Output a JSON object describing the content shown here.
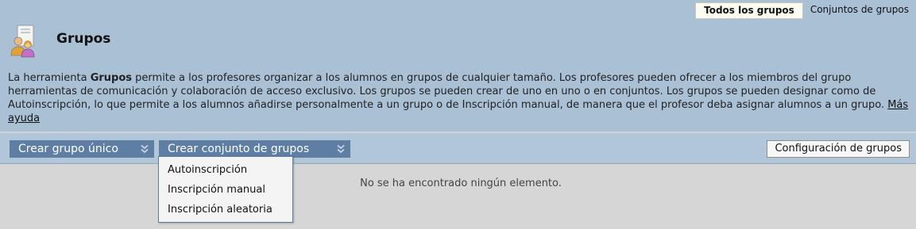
{
  "view_tabs": [
    {
      "label": "Todos los grupos",
      "active": true
    },
    {
      "label": "Conjuntos de grupos",
      "active": false
    }
  ],
  "page": {
    "title": "Grupos",
    "icon": "group-people-icon"
  },
  "description": {
    "part1": "La herramienta ",
    "bold": "Grupos",
    "part2": " permite a los profesores organizar a los alumnos en grupos de cualquier tamaño. Los profesores pueden ofrecer a los miembros del grupo herramientas de comunicación y colaboración de acceso exclusivo. Los grupos se pueden crear de uno en uno o en conjuntos. Los grupos se pueden designar como de Autoinscripción, lo que permite a los alumnos añadirse personalmente a un grupo o de Inscripción manual, de manera que el profesor deba asignar alumnos a un grupo. ",
    "help_link": "Más ayuda"
  },
  "actions": {
    "create_single": "Crear grupo único",
    "create_set": "Crear conjunto de grupos",
    "config": "Configuración de grupos"
  },
  "dropdown": {
    "items": [
      "Autoinscripción",
      "Inscripción manual",
      "Inscripción aleatoria"
    ]
  },
  "empty_message": "No se ha encontrado ningún elemento.",
  "colors": {
    "header_bg": "#a9c0d5",
    "button_bg": "#5e7ea4",
    "content_bg": "#d6d6d6"
  }
}
